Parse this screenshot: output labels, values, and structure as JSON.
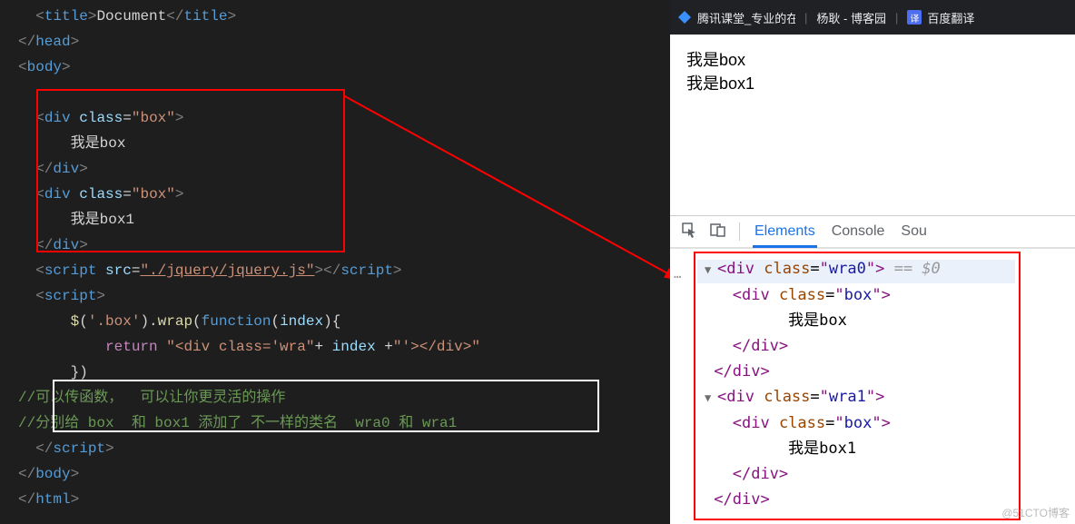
{
  "editor": {
    "line1": "<title>Document</title>",
    "line2": "</head>",
    "line3": "<body>",
    "line4": "<div class=\"box\">",
    "line5": "我是box",
    "line6": "</div>",
    "line7": "<div class=\"box\">",
    "line8": "我是box1",
    "line9": "</div>",
    "script_src": "./jquery/jquery.js",
    "code": {
      "l1": "$('.box').wrap(function(index){",
      "l2": "return \"<div class='wra\"+ index +\"'></div>\"",
      "l3": "})"
    },
    "comment1": "//可以传函数，  可以让你更灵活的操作",
    "comment2": "//分别给 box  和 box1 添加了 不一样的类名  wra0 和 wra1",
    "close_body": "</body>",
    "close_html": "</html>"
  },
  "tabs": {
    "t1": "腾讯课堂_专业的在...",
    "t2": "杨耿 - 博客园",
    "t3": "百度翻译"
  },
  "page": {
    "l1": "我是box",
    "l2": "我是box1"
  },
  "devtools": {
    "tab_elements": "Elements",
    "tab_console": "Console",
    "tab_sources": "Sou",
    "sel_hint": "== $0",
    "nodes": {
      "wra0_open": "<div class=\"wra0\">",
      "box_open": "<div class=\"box\">",
      "box_text": "我是box",
      "box_close": "</div>",
      "wra0_close": "</div>",
      "wra1_open": "<div class=\"wra1\">",
      "box1_open": "<div class=\"box\">",
      "box1_text": "我是box1",
      "box1_close": "</div>",
      "wra1_close": "</div>"
    }
  },
  "watermark": "@51CTO博客"
}
